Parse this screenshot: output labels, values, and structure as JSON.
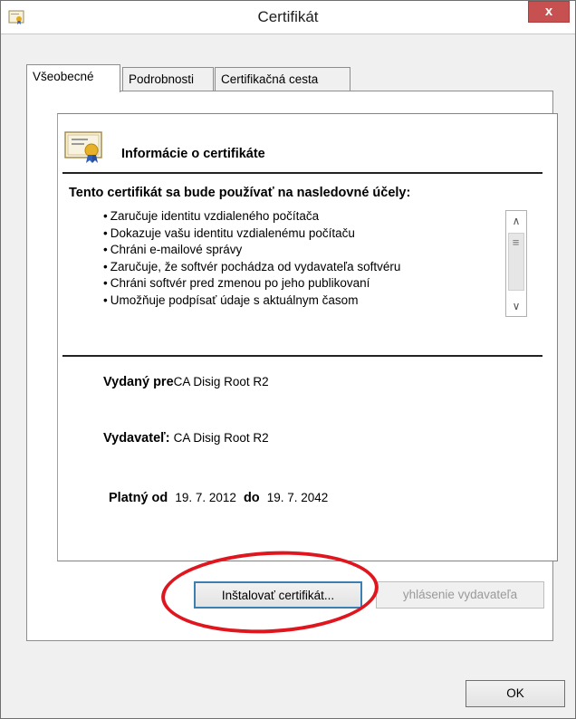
{
  "window": {
    "title": "Certifikát",
    "close_label": "x"
  },
  "tabs": [
    {
      "label": "Všeobecné",
      "active": true
    },
    {
      "label": "Podrobnosti",
      "active": false
    },
    {
      "label": "Certifikačná cesta",
      "active": false
    }
  ],
  "info": {
    "heading": "Informácie o certifikáte",
    "purposes_title": "Tento certifikát sa bude používať na nasledovné účely:",
    "purposes": [
      "Zaručuje identitu vzdialeného počítača",
      "Dokazuje vašu identitu vzdialenému počítaču",
      "Chráni e-mailové správy",
      "Zaručuje, že softvér pochádza od vydavateľa softvéru",
      "Chráni softvér pred zmenou po jeho publikovaní",
      "Umožňuje podpísať údaje s aktuálnym časom"
    ],
    "issued_to_label": "Vydaný pre",
    "issued_to_value": "CA Disig Root R2",
    "issuer_label": "Vydavateľ:",
    "issuer_value": "CA Disig Root R2",
    "valid_from_label": "Platný od",
    "valid_from_value": "19. 7. 2012",
    "valid_to_label": "do",
    "valid_to_value": "19. 7. 2042"
  },
  "buttons": {
    "install": "Inštalovať certifikát...",
    "issuer_statement": "yhlásenie vydavateľa",
    "ok": "OK"
  },
  "colors": {
    "highlight": "#e0161f",
    "close_button": "#c75050"
  }
}
